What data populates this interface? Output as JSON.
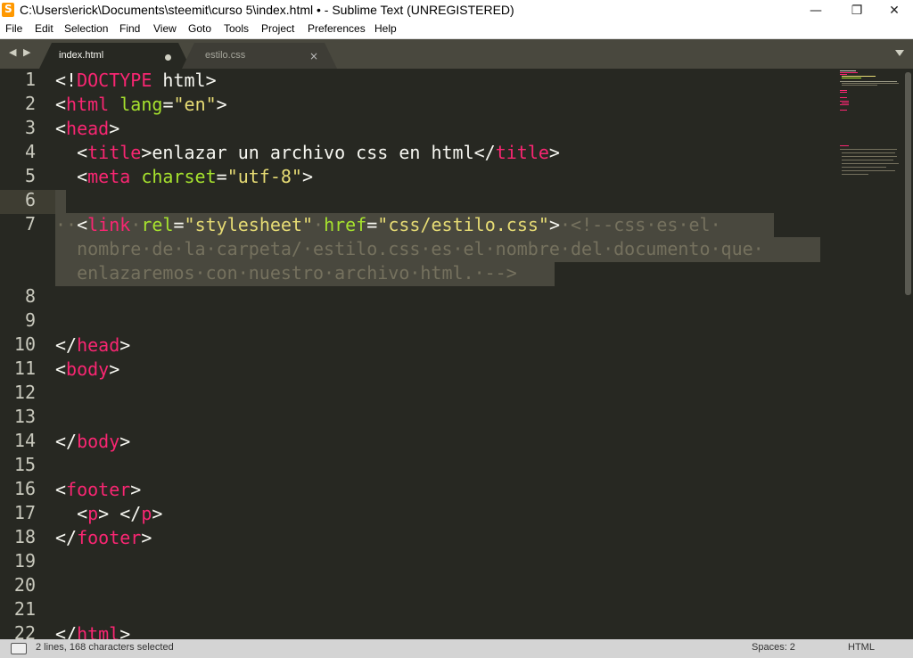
{
  "window": {
    "title": "C:\\Users\\erick\\Documents\\steemit\\curso 5\\index.html • - Sublime Text (UNREGISTERED)",
    "icon": "sublime-text-icon",
    "buttons": {
      "minimize": "—",
      "maximize": "❐",
      "close": "✕"
    }
  },
  "menu": [
    {
      "label": "File"
    },
    {
      "label": "Edit"
    },
    {
      "label": "Selection"
    },
    {
      "label": "Find"
    },
    {
      "label": "View"
    },
    {
      "label": "Goto"
    },
    {
      "label": "Tools"
    },
    {
      "label": "Project"
    },
    {
      "label": "Preferences"
    },
    {
      "label": "Help"
    }
  ],
  "tabs": [
    {
      "label": "index.html",
      "active": true,
      "dirty": true
    },
    {
      "label": "estilo.css",
      "active": false,
      "dirty": false,
      "close": "×"
    }
  ],
  "nav": {
    "arrows": "◀ ▶"
  },
  "editor": {
    "line_numbers": [
      "1",
      "2",
      "3",
      "4",
      "5",
      "6",
      "7",
      "8",
      "9",
      "10",
      "11",
      "12",
      "13",
      "14",
      "15",
      "16",
      "17",
      "18",
      "19",
      "20",
      "21",
      "22"
    ],
    "lines": [
      [
        {
          "t": "<!",
          "c": "p"
        },
        {
          "t": "DOCTYPE",
          "c": "k"
        },
        {
          "t": " html>",
          "c": "p"
        }
      ],
      [
        {
          "t": "<",
          "c": "p"
        },
        {
          "t": "html",
          "c": "k"
        },
        {
          "t": " ",
          "c": "p"
        },
        {
          "t": "lang",
          "c": "a"
        },
        {
          "t": "=",
          "c": "p"
        },
        {
          "t": "\"en\"",
          "c": "s"
        },
        {
          "t": ">",
          "c": "p"
        }
      ],
      [
        {
          "t": "<",
          "c": "p"
        },
        {
          "t": "head",
          "c": "k"
        },
        {
          "t": ">",
          "c": "p"
        }
      ],
      [
        {
          "t": "  <",
          "c": "p"
        },
        {
          "t": "title",
          "c": "k"
        },
        {
          "t": ">enlazar un archivo css en html</",
          "c": "p"
        },
        {
          "t": "title",
          "c": "k"
        },
        {
          "t": ">",
          "c": "p"
        }
      ],
      [
        {
          "t": "  <",
          "c": "p"
        },
        {
          "t": "meta",
          "c": "k"
        },
        {
          "t": " ",
          "c": "p"
        },
        {
          "t": "charset",
          "c": "a"
        },
        {
          "t": "=",
          "c": "p"
        },
        {
          "t": "\"utf-8\"",
          "c": "s"
        },
        {
          "t": ">",
          "c": "p"
        }
      ],
      [],
      [
        {
          "t": "··",
          "c": "ws"
        },
        {
          "t": "<",
          "c": "p"
        },
        {
          "t": "link",
          "c": "k"
        },
        {
          "t": "·",
          "c": "ws"
        },
        {
          "t": "rel",
          "c": "a"
        },
        {
          "t": "=",
          "c": "p"
        },
        {
          "t": "\"stylesheet\"",
          "c": "s"
        },
        {
          "t": "·",
          "c": "ws"
        },
        {
          "t": "href",
          "c": "a"
        },
        {
          "t": "=",
          "c": "p"
        },
        {
          "t": "\"css/estilo.css\"",
          "c": "s"
        },
        {
          "t": ">",
          "c": "p"
        },
        {
          "t": "·<!--css·es·el·",
          "c": "c"
        }
      ],
      [
        {
          "t": "  nombre·de·la·carpeta/·estilo.css·es·el·nombre·del·documento·que·",
          "c": "c"
        }
      ],
      [
        {
          "t": "  enlazaremos·con·nuestro·archivo·html.·-->",
          "c": "c"
        }
      ],
      [],
      [],
      [
        {
          "t": "</",
          "c": "p"
        },
        {
          "t": "head",
          "c": "k"
        },
        {
          "t": ">",
          "c": "p"
        }
      ],
      [
        {
          "t": "<",
          "c": "p"
        },
        {
          "t": "body",
          "c": "k"
        },
        {
          "t": ">",
          "c": "p"
        }
      ],
      [],
      [],
      [
        {
          "t": "</",
          "c": "p"
        },
        {
          "t": "body",
          "c": "k"
        },
        {
          "t": ">",
          "c": "p"
        }
      ],
      [],
      [
        {
          "t": "<",
          "c": "p"
        },
        {
          "t": "footer",
          "c": "k"
        },
        {
          "t": ">",
          "c": "p"
        }
      ],
      [
        {
          "t": "  <",
          "c": "p"
        },
        {
          "t": "p",
          "c": "k"
        },
        {
          "t": "> </",
          "c": "p"
        },
        {
          "t": "p",
          "c": "k"
        },
        {
          "t": ">",
          "c": "p"
        }
      ],
      [
        {
          "t": "</",
          "c": "p"
        },
        {
          "t": "footer",
          "c": "k"
        },
        {
          "t": ">",
          "c": "p"
        }
      ],
      [],
      [],
      [],
      [
        {
          "t": "</",
          "c": "p"
        },
        {
          "t": "html",
          "c": "k"
        },
        {
          "t": ">",
          "c": "p"
        }
      ],
      []
    ]
  },
  "status": {
    "selection": "2 lines, 168 characters selected",
    "indent": "Spaces: 2",
    "syntax": "HTML"
  },
  "colors": {
    "background": "#272822",
    "keyword": "#f92672",
    "attribute": "#a6e22e",
    "string": "#e6db74",
    "comment": "#75715e",
    "selection": "#49483e"
  }
}
